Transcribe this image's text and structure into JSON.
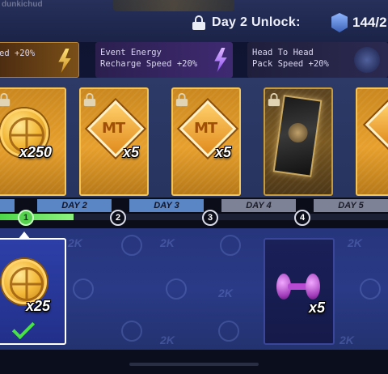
{
  "header": {
    "username": "dunkichud",
    "unlock_label": "Day 2 Unlock:",
    "badge_count": "144/2"
  },
  "boosts": [
    {
      "text": "ed +20%",
      "icon": "lightning-bolt-gold-icon"
    },
    {
      "text": "Event Energy\nRecharge Speed +20%",
      "icon": "lightning-bolt-purple-icon"
    },
    {
      "text": "Head To Head\nPack Speed +20%",
      "icon": "head-to-head-logo-icon"
    }
  ],
  "rewards": [
    {
      "item": "basketball-coin-icon",
      "quantity": "x250",
      "locked": true
    },
    {
      "item": "mt-token-icon",
      "quantity": "x5",
      "locked": true
    },
    {
      "item": "mt-token-icon",
      "quantity": "x5",
      "locked": true
    },
    {
      "item": "card-pack-icon",
      "quantity": "",
      "locked": true
    },
    {
      "item": "mt-token-icon",
      "quantity": "",
      "locked": false
    }
  ],
  "timeline": {
    "days": [
      "DAY 2",
      "DAY 3",
      "DAY 4",
      "DAY 5"
    ],
    "nodes": [
      "1",
      "2",
      "3",
      "4"
    ],
    "progress": 0.19
  },
  "lower_rewards": [
    {
      "item": "basketball-coin-icon",
      "quantity": "x25",
      "claimed": true
    },
    {
      "item": "dumbbell-icon",
      "quantity": "x5",
      "claimed": false
    }
  ],
  "watermark": "2K",
  "mt_label": "MT",
  "colors": {
    "accent_gold": "#e7a02c",
    "progress_green": "#56d24f",
    "day_blue": "#5a86c6"
  }
}
